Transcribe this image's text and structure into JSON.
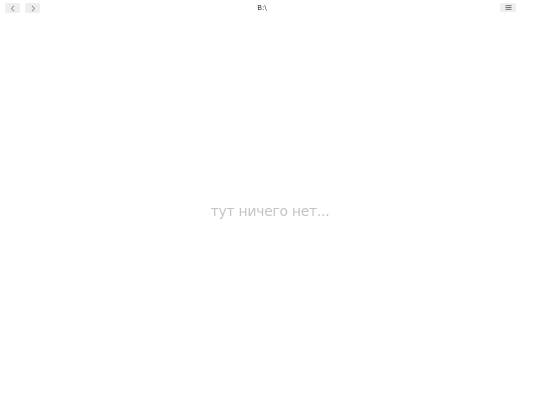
{
  "toolbar": {
    "back_icon": "chevron-left-icon",
    "forward_icon": "chevron-right-icon",
    "path": "B:\\",
    "menu_icon": "hamburger-menu-icon"
  },
  "main": {
    "empty_message": "тут ничего нет..."
  },
  "colors": {
    "button_bg": "#eeeeee",
    "placeholder_text": "#c4c4c4"
  }
}
